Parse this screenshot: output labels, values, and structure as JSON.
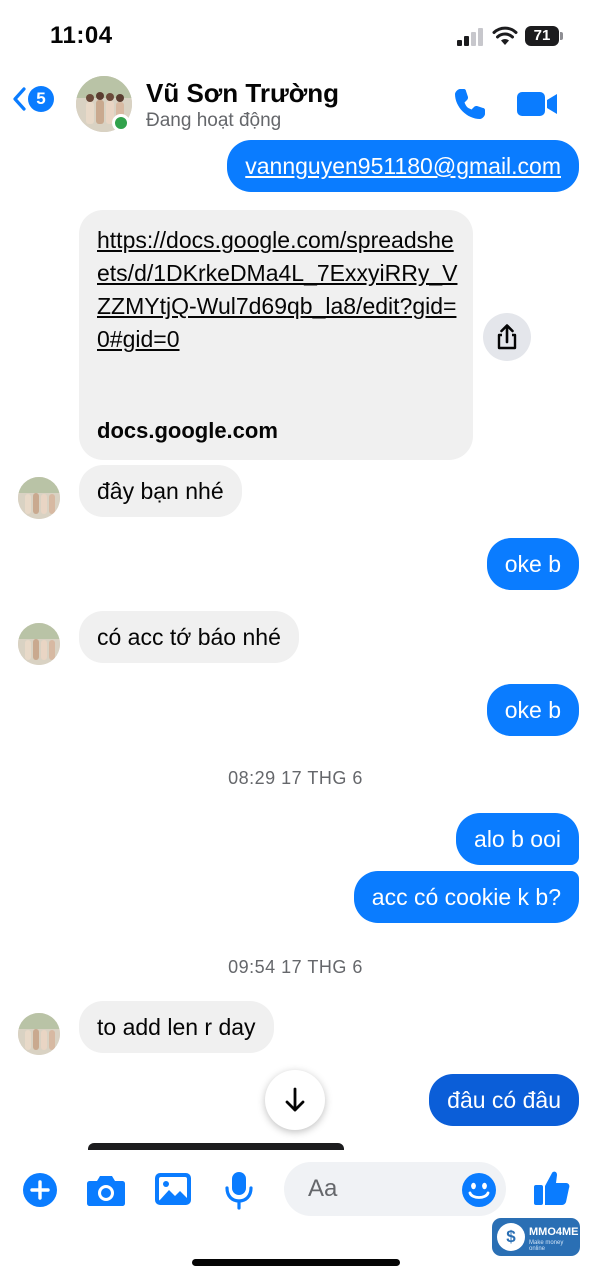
{
  "status_bar": {
    "time": "11:04",
    "battery": "71"
  },
  "header": {
    "unread_count": "5",
    "contact_name": "Vũ Sơn Trường",
    "contact_status": "Đang hoạt động"
  },
  "messages": {
    "m1": "vannguyen951180@gmail.com",
    "link_url": "https://docs.google.com/spreadsheets/d/1DKrkeDMa4L_7ExxyiRRy_VZZMYtjQ-Wul7d69qb_la8/edit?gid=0#gid=0",
    "link_domain": "docs.google.com",
    "m2": "đây bạn nhé",
    "m3": "oke b",
    "m4": "có acc tớ báo nhé",
    "m5": "oke b",
    "ts1": "08:29 17 THG 6",
    "m6": "alo b ooi",
    "m7": "acc có cookie k b?",
    "ts2": "09:54 17 THG 6",
    "m8": "to add len r day",
    "m9": "đâu có đâu"
  },
  "composer": {
    "placeholder": "Aa"
  },
  "watermark": {
    "text": "MMO4ME",
    "sub": "Make money online"
  },
  "colors": {
    "accent": "#0a7cff",
    "incoming_bubble": "#f0f0f0",
    "online": "#31a24c"
  }
}
